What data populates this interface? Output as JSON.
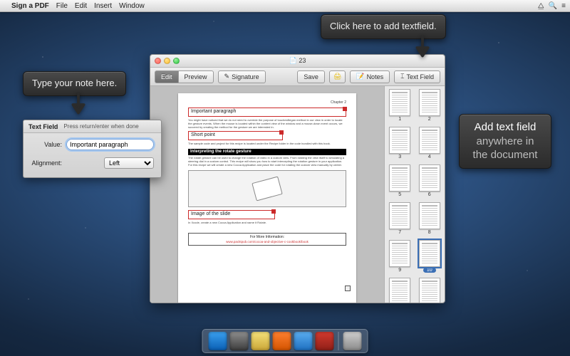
{
  "menubar": {
    "app": "Sign a PDF",
    "items": [
      "File",
      "Edit",
      "Insert",
      "Window"
    ]
  },
  "window": {
    "title": "23",
    "toolbar": {
      "edit": "Edit",
      "preview": "Preview",
      "signature": "Signature",
      "save": "Save",
      "notes": "Notes",
      "textfield": "Text Field"
    }
  },
  "page": {
    "chapter": "Chapter 2",
    "box1": "Important paragraph",
    "para1": "You might have noticed that we do not need to override the purpose of touchesBegan method in our view in order to locate the gesture events. When the mouse is located within the content view of the window and a mouse-down event occurs, we succeed by creating the method for the gesture we are interested in.",
    "box2": "Short point",
    "para2": "The sample code and project for this recipe is located under the Recipe folder in the code bundled with this book.",
    "heading": "Interpreting the rotate gesture",
    "para3": "The rotate gesture can be used to change the rotation of video in a custom view. From rotating the view itself to simulating a steering dial in a custom control. This recipe will show you how to start intercepting the rotation gesture in your application. For this recipe we will create a new Cocoa Application and place the code for rotating the custom view manually by center.",
    "box3": "Image of the slide",
    "para4": "In Xcode, create a new Cocoa Application and name it Rotate.",
    "footer_title": "For More Information:",
    "footer_link": "www.packtpub.com/cocoa-and-objective-c-cookbook/book"
  },
  "thumbs": {
    "count": 12,
    "selected": 10
  },
  "inspector": {
    "title": "Text Field",
    "hint": "Press return/enter when done",
    "value_label": "Value:",
    "value": "Important paragraph",
    "align_label": "Alignment:",
    "align_value": "Left"
  },
  "callouts": {
    "typeNote": "Type your note here.",
    "clickAdd": "Click here to add textfield.",
    "anywhere_l1": "Add text field",
    "anywhere_l2": "anywhere in",
    "anywhere_l3": "the document"
  },
  "dock": {
    "icons": [
      {
        "name": "finder-icon",
        "bg": "linear-gradient(#3aa0f0,#0a5fb4)"
      },
      {
        "name": "launchpad-icon",
        "bg": "linear-gradient(#8f8f8f,#3c3c3c)"
      },
      {
        "name": "preview-icon",
        "bg": "linear-gradient(#f6e27a,#caa637)"
      },
      {
        "name": "pages-icon",
        "bg": "linear-gradient(#ff8030,#d35400)"
      },
      {
        "name": "appstore-icon",
        "bg": "linear-gradient(#5aaef2,#1e6fbf)"
      },
      {
        "name": "sign-a-pdf-icon",
        "bg": "linear-gradient(#d33a2f,#8f1f17)"
      }
    ],
    "trash": {
      "name": "trash-icon",
      "bg": "linear-gradient(#cfcfcf,#8a8a8a)"
    }
  }
}
